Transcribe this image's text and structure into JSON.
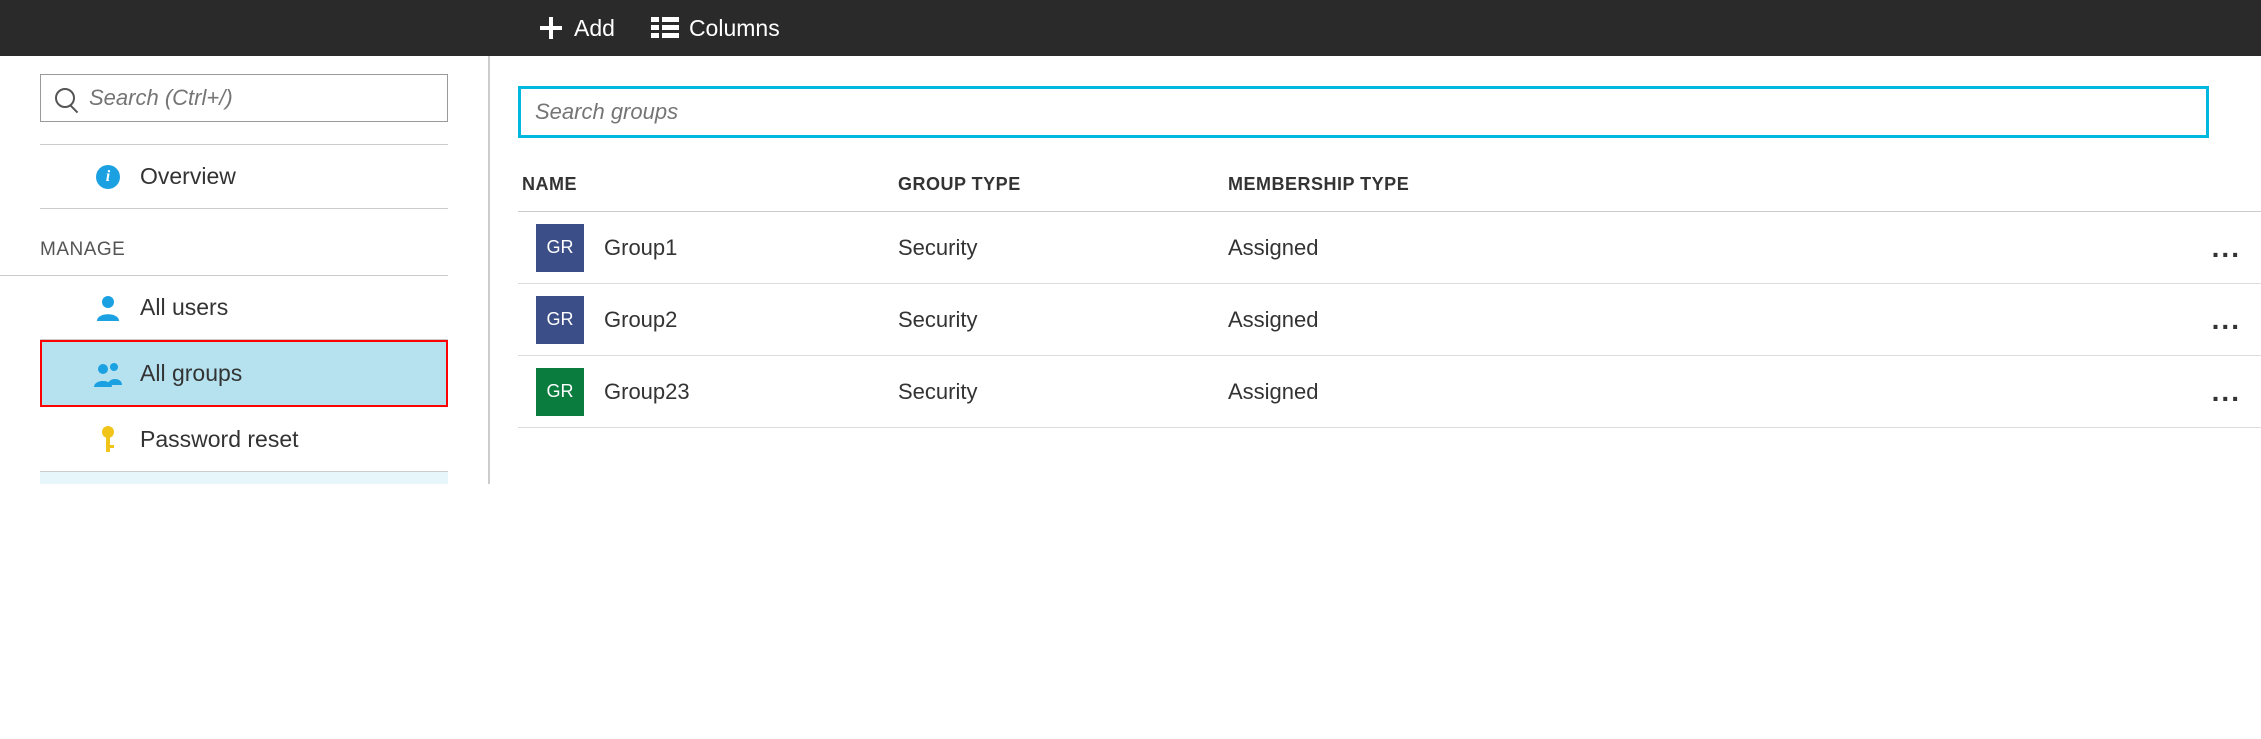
{
  "toolbar": {
    "add_label": "Add",
    "columns_label": "Columns"
  },
  "sidebar": {
    "search_placeholder": "Search (Ctrl+/)",
    "overview_label": "Overview",
    "manage_header": "MANAGE",
    "items": [
      {
        "label": "All users"
      },
      {
        "label": "All groups"
      },
      {
        "label": "Password reset"
      }
    ]
  },
  "main": {
    "search_placeholder": "Search groups",
    "columns": {
      "name": "NAME",
      "group_type": "GROUP TYPE",
      "membership_type": "MEMBERSHIP TYPE"
    },
    "rows": [
      {
        "avatar": "GR",
        "avatar_color": "blue",
        "name": "Group1",
        "group_type": "Security",
        "membership_type": "Assigned"
      },
      {
        "avatar": "GR",
        "avatar_color": "blue",
        "name": "Group2",
        "group_type": "Security",
        "membership_type": "Assigned"
      },
      {
        "avatar": "GR",
        "avatar_color": "green",
        "name": "Group23",
        "group_type": "Security",
        "membership_type": "Assigned"
      }
    ],
    "more_glyph": "..."
  }
}
